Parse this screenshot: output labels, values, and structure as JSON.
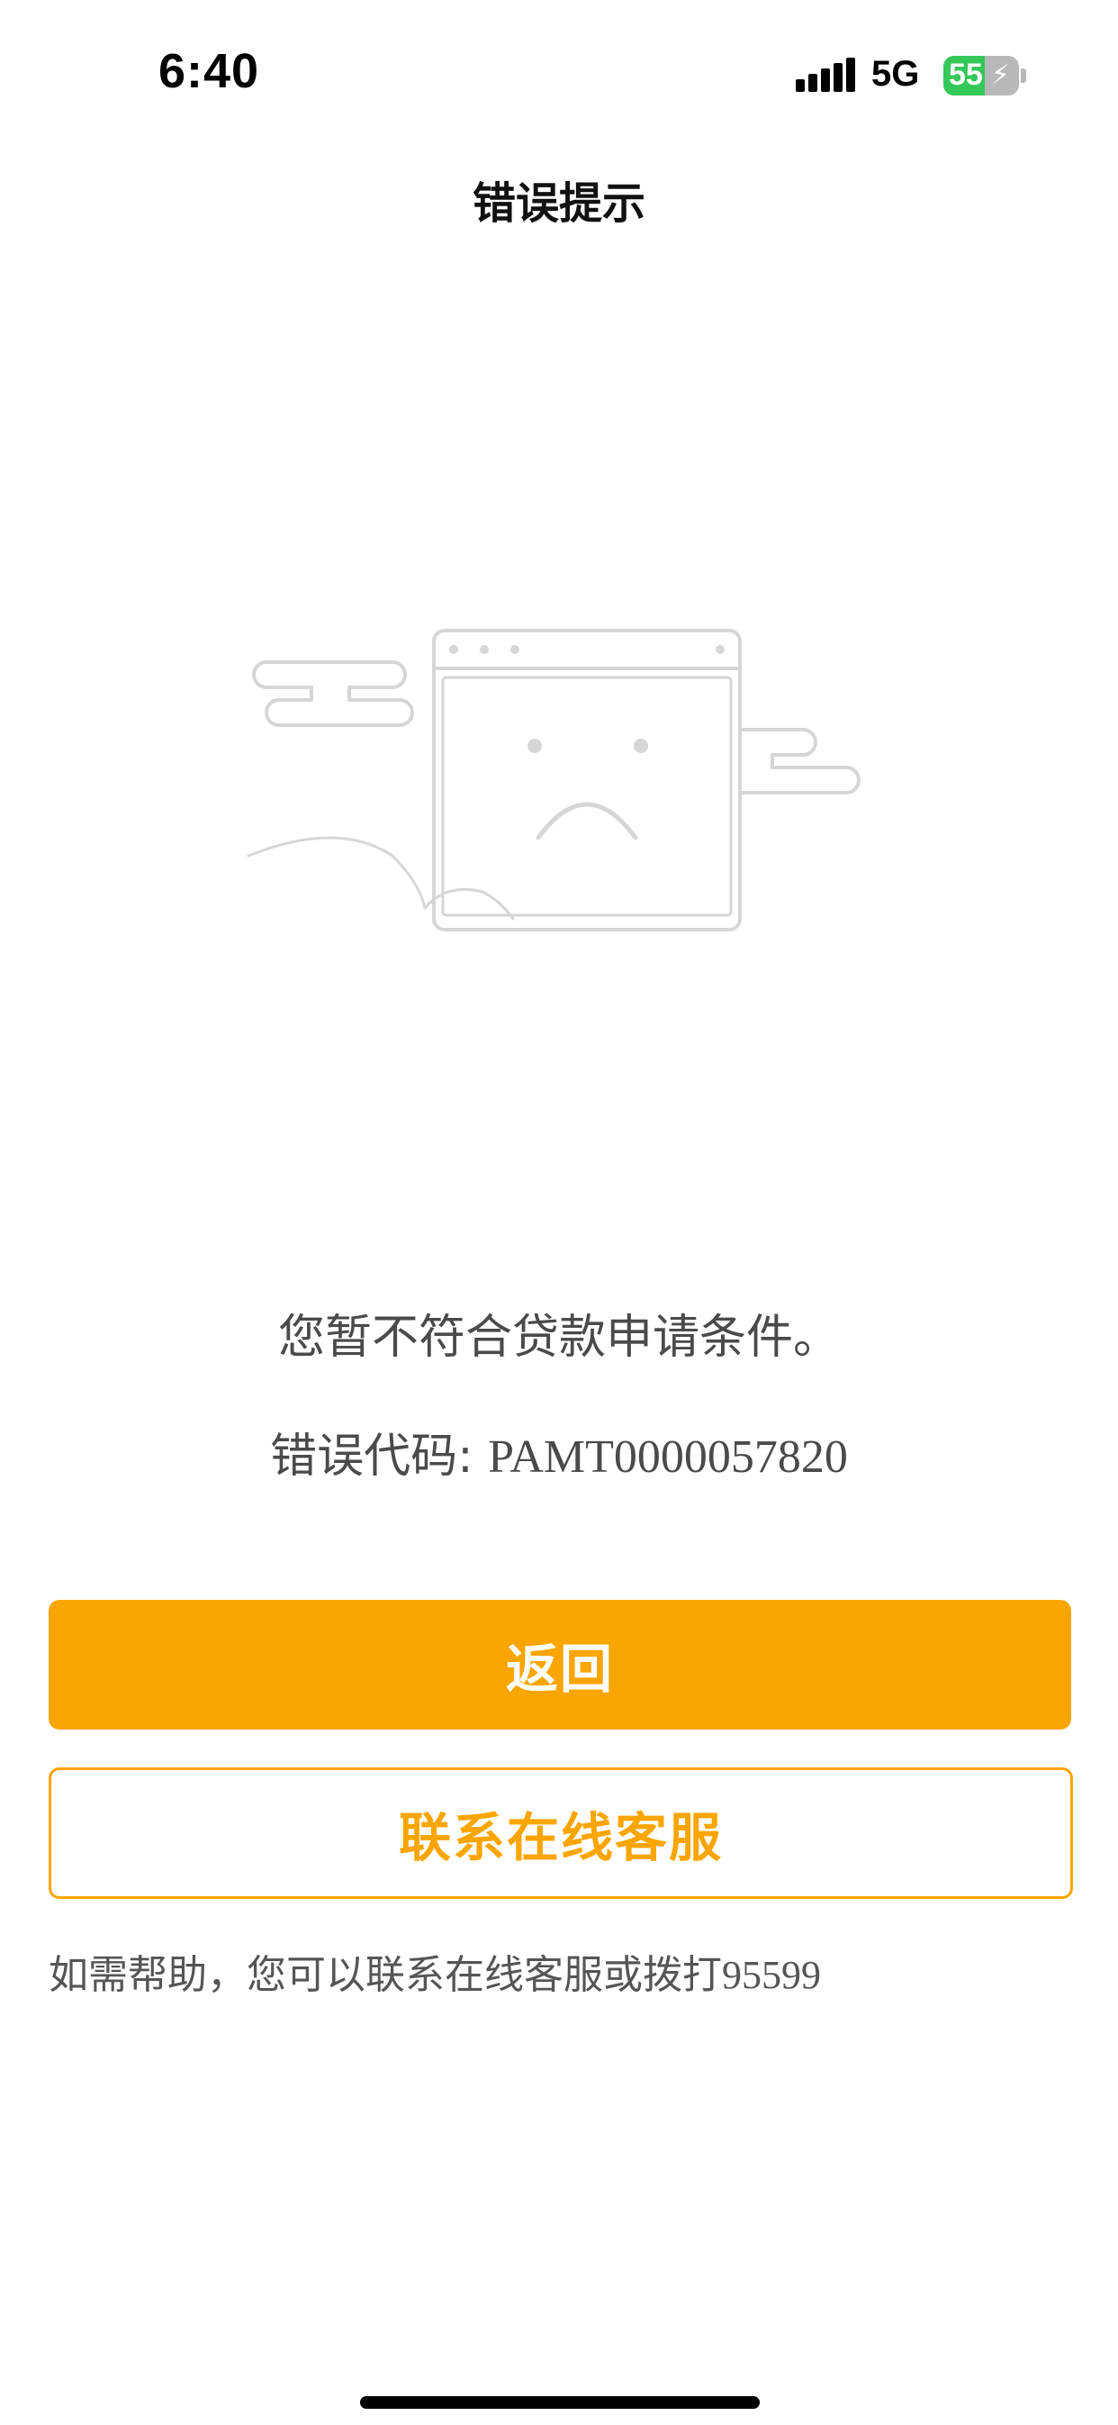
{
  "status_bar": {
    "time": "6:40",
    "network": "5G",
    "battery_level": "55",
    "battery_charging_icon": "bolt-icon",
    "signal_icon": "signal-bars-icon"
  },
  "header": {
    "title": "错误提示"
  },
  "illustration": {
    "icon": "sad-browser-window-illustration"
  },
  "content": {
    "message": "您暂不符合贷款申请条件。",
    "error_label": "错误代码: ",
    "error_code": "PAMT0000057820"
  },
  "actions": {
    "back_label": "返回",
    "contact_label": "联系在线客服"
  },
  "help": {
    "text": "如需帮助，您可以联系在线客服或拨打",
    "phone": "95599"
  },
  "colors": {
    "accent": "#fba500",
    "text": "#4a4a4a",
    "illustration_stroke": "#d6d6d6",
    "battery_fill": "#34c759"
  }
}
